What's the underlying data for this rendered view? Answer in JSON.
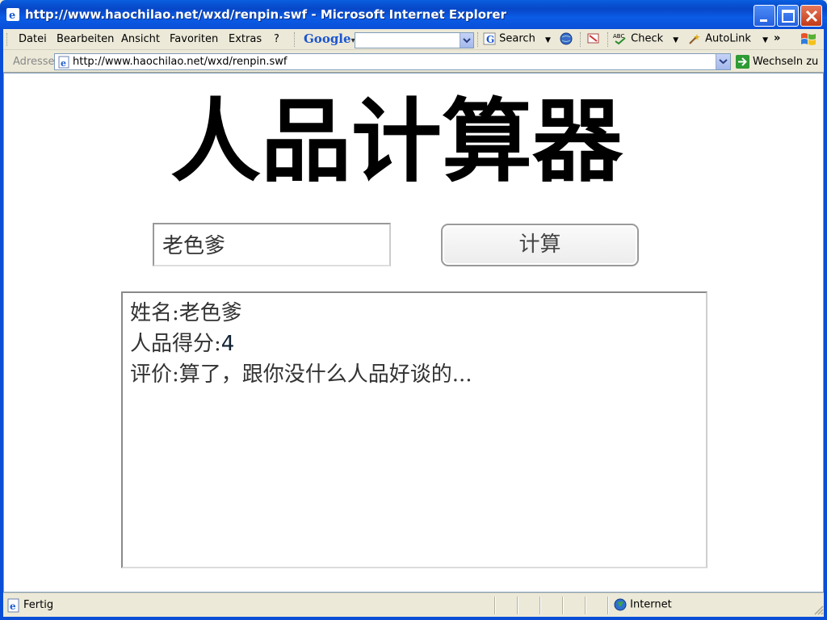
{
  "window": {
    "title": "http://www.haochilao.net/wxd/renpin.swf - Microsoft Internet Explorer"
  },
  "menu": {
    "items": [
      "Datei",
      "Bearbeiten",
      "Ansicht",
      "Favoriten",
      "Extras",
      "?"
    ]
  },
  "google_toolbar": {
    "logo": "Google",
    "search_label": "Search",
    "check_label": "Check",
    "autolink_label": "AutoLink",
    "more_label": "»"
  },
  "address_bar": {
    "label": "Adresse",
    "url": "http://www.haochilao.net/wxd/renpin.swf",
    "go_label": "Wechseln zu"
  },
  "app": {
    "title": "人品计算器",
    "name_input_value": "老色爹",
    "calc_button_label": "计算",
    "result": {
      "name_label": "姓名:",
      "name_value": "老色爹",
      "score_label": "人品得分:",
      "score_value": "4",
      "comment_label": "评价:",
      "comment_value": "算了，跟你没什么人品好谈的..."
    }
  },
  "status_bar": {
    "status": "Fertig",
    "zone": "Internet"
  },
  "colors": {
    "titlebar": "#0a5fe0",
    "chrome": "#ece9d8",
    "content_bg": "#ffffff"
  }
}
